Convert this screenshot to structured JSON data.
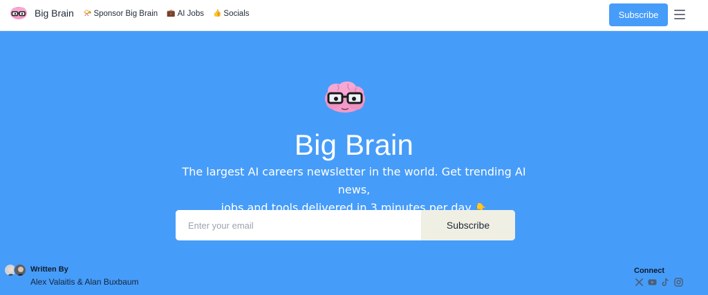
{
  "header": {
    "brand_name": "Big Brain",
    "nav": [
      {
        "emoji": "📯",
        "label": "Sponsor Big Brain"
      },
      {
        "emoji": "💼",
        "label": "AI Jobs"
      },
      {
        "emoji": "👍",
        "label": "Socials"
      }
    ],
    "subscribe_label": "Subscribe",
    "menu_icon": "hamburger-menu-icon"
  },
  "hero": {
    "logo_icon": "brain-with-glasses-icon",
    "title": "Big Brain",
    "tagline_line1": "The largest AI careers newsletter in the world. Get trending AI news,",
    "tagline_line2": "jobs and tools delivered in 3 minutes per day",
    "tagline_emoji": "👇",
    "email_placeholder": "Enter your email",
    "email_value": "",
    "subscribe_label": "Subscribe"
  },
  "footer": {
    "written_by_label": "Written By",
    "authors": "Alex Valaitis & Alan Buxbaum",
    "connect_label": "Connect",
    "socials": [
      "x-icon",
      "youtube-icon",
      "tiktok-icon",
      "instagram-icon"
    ]
  },
  "colors": {
    "accent": "#469cf9",
    "hero_bg": "#469cf9",
    "subscribe_main_bg": "#f0efe3",
    "footer_text": "#14243a"
  }
}
